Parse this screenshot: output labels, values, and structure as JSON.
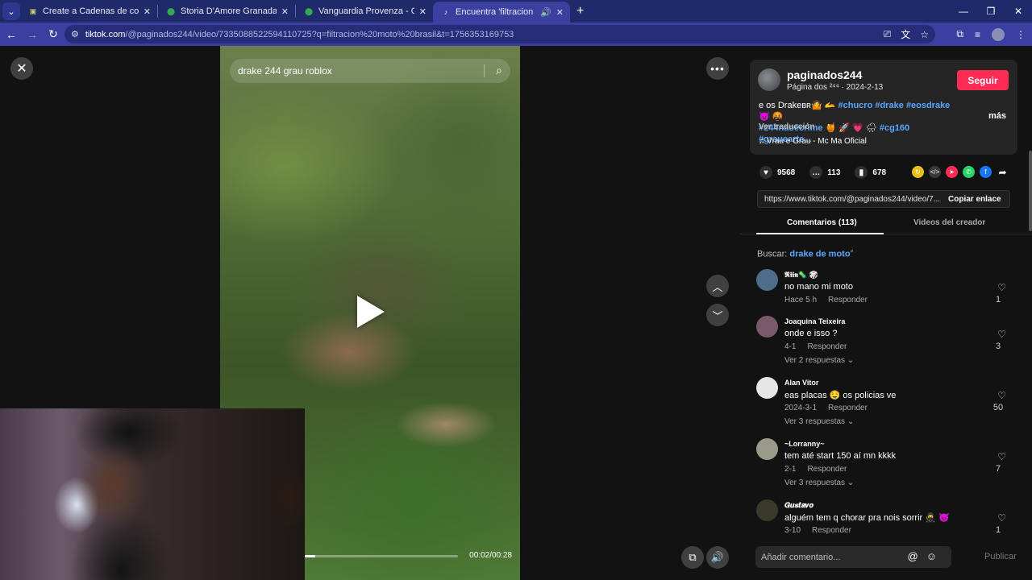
{
  "browser": {
    "tabs": [
      {
        "title": "Create a Cadenas de comidas r",
        "fav": "▣",
        "fav_color": "#6b7d2a"
      },
      {
        "title": "Storia D'Amore Granada - Goo",
        "fav": "📍",
        "fav_color": "#34a853"
      },
      {
        "title": "Vanguardia Provenza - Google",
        "fav": "📍",
        "fav_color": "#34a853"
      },
      {
        "title": "Encuentra 'filtracion moto b",
        "fav": "♪",
        "fav_color": "#000000",
        "active": true
      }
    ],
    "url_host": "tiktok.com",
    "url_path": "/@paginados244/video/7335088522594110725?q=filtracion%20moto%20brasil&t=1756353169753"
  },
  "video": {
    "search_text": "drake 244 grau roblox",
    "time": "00:02/00:28",
    "progress": 0.07
  },
  "creator": {
    "username": "paginados244",
    "subtitle": "Página dos ²⁴⁴ · 2024-2-13",
    "follow_label": "Seguir",
    "desc_prefix": "e os Drakeʙʀ🤷 🫴 ",
    "desc_tags_line1": "#chucro #drake #eosdrake",
    "desc_emoji1": " 👿 🤬",
    "desc_tag2": "#244naoécrime",
    "desc_emoji2": " 🍯 🚀 💗 🌧 ",
    "desc_tags_line2": "#cg160 #grauearte...",
    "more": "más",
    "translate": "Ver traducción",
    "music": "♫  Vrau e Grau - Mc Ma Oficial"
  },
  "stats": {
    "likes": "9568",
    "comments": "113",
    "saves": "678"
  },
  "link": {
    "url": "https://www.tiktok.com/@paginados244/video/7...",
    "copy_label": "Copiar enlace"
  },
  "tabs": {
    "comments": "Comentarios (113)",
    "creator_videos": "Videos del creador"
  },
  "search": {
    "label": "Buscar: ",
    "query": "drake de moto"
  },
  "comments": [
    {
      "name": "𝕽𝖎𝖎𝖓🦠 🎲",
      "text": "no mano mi moto",
      "time": "Hace 5 h",
      "reply": "Responder",
      "likes": "1",
      "replies": "",
      "avatar": "#4f6d8a"
    },
    {
      "name": "Joaquina Teixeira",
      "text": "onde e isso ?",
      "time": "4-1",
      "reply": "Responder",
      "likes": "3",
      "replies": "Ver 2 respuestas ⌄",
      "avatar": "#7a5a6a"
    },
    {
      "name": "Alan Vitor",
      "text": "eas placas 🤤 os policias ve",
      "time": "2024-3-1",
      "reply": "Responder",
      "likes": "50",
      "replies": "Ver 3 respuestas ⌄",
      "avatar": "#e6e6e6"
    },
    {
      "name": "~Lorranny~",
      "text": "tem até start 150 aí mn kkkk",
      "time": "2-1",
      "reply": "Responder",
      "likes": "7",
      "replies": "Ver 3 respuestas ⌄",
      "avatar": "#9a9a8a"
    },
    {
      "name": "𝑮𝒖𝒔𝒕𝒂𝒗𝒐",
      "text": "alguém tem q chorar pra nois sorrir 🥷 👿",
      "time": "3-10",
      "reply": "Responder",
      "likes": "1",
      "replies": "",
      "avatar": "#3a3a2a"
    }
  ],
  "composer": {
    "placeholder": "Añadir comentario...",
    "publish": "Publicar"
  }
}
